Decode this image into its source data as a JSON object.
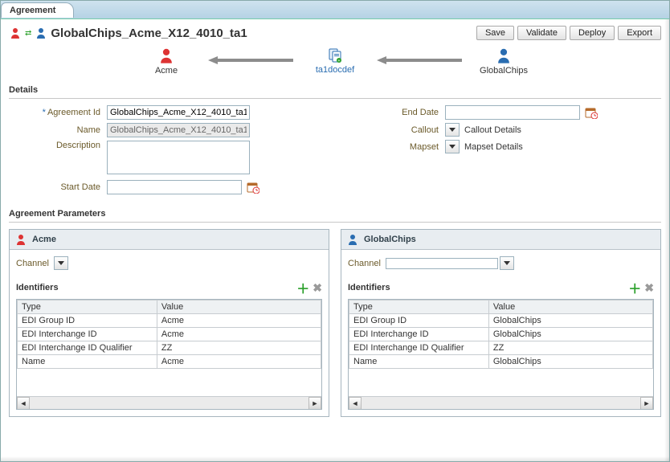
{
  "tab": {
    "title": "Agreement"
  },
  "header": {
    "title": "GlobalChips_Acme_X12_4010_ta1",
    "buttons": {
      "save": "Save",
      "validate": "Validate",
      "deploy": "Deploy",
      "export": "Export"
    }
  },
  "flow": {
    "left": "Acme",
    "middle": "ta1docdef",
    "right": "GlobalChips"
  },
  "details": {
    "heading": "Details",
    "agreement_id_label": "Agreement Id",
    "agreement_id": "GlobalChips_Acme_X12_4010_ta1",
    "name_label": "Name",
    "name": "GlobalChips_Acme_X12_4010_ta1",
    "description_label": "Description",
    "description": "",
    "start_date_label": "Start Date",
    "start_date": "",
    "end_date_label": "End Date",
    "end_date": "",
    "callout_label": "Callout",
    "callout_link": "Callout Details",
    "mapset_label": "Mapset",
    "mapset_link": "Mapset Details"
  },
  "params": {
    "heading": "Agreement Parameters",
    "left": {
      "title": "Acme",
      "channel_label": "Channel",
      "identifiers_label": "Identifiers",
      "cols": {
        "type": "Type",
        "value": "Value"
      },
      "rows": [
        {
          "type": "EDI Group ID",
          "value": "Acme"
        },
        {
          "type": "EDI Interchange ID",
          "value": "Acme"
        },
        {
          "type": "EDI Interchange ID Qualifier",
          "value": "ZZ"
        },
        {
          "type": "Name",
          "value": "Acme"
        }
      ]
    },
    "right": {
      "title": "GlobalChips",
      "channel_label": "Channel",
      "identifiers_label": "Identifiers",
      "cols": {
        "type": "Type",
        "value": "Value"
      },
      "rows": [
        {
          "type": "EDI Group ID",
          "value": "GlobalChips"
        },
        {
          "type": "EDI Interchange ID",
          "value": "GlobalChips"
        },
        {
          "type": "EDI Interchange ID Qualifier",
          "value": "ZZ"
        },
        {
          "type": "Name",
          "value": "GlobalChips"
        }
      ]
    }
  }
}
